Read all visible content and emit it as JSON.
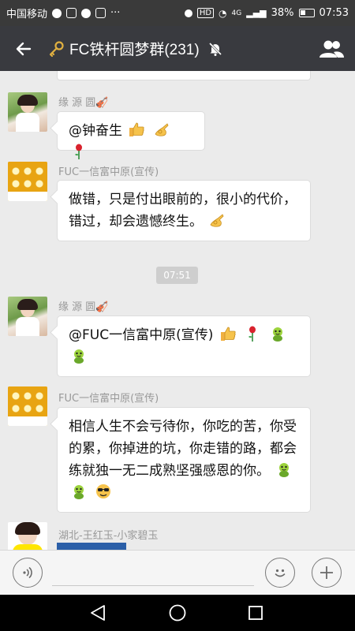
{
  "status_bar": {
    "carrier": "中国移动",
    "network": "HD",
    "signal": "4G",
    "battery": "38%",
    "time": "07:53"
  },
  "header": {
    "title": "FC铁杆圆梦群(231)",
    "back_icon": "arrow-left-icon",
    "key_icon": "key-icon",
    "mute_icon": "mute-bell-icon",
    "group_icon": "group-members-icon"
  },
  "messages": [
    {
      "sender": "缘 源 圆🎻",
      "text": "@钟奋生",
      "emojis": [
        "thumbs-up",
        "ok-hand",
        "rose"
      ]
    },
    {
      "sender": "FUC一信富中原(宣传)",
      "text": "做错，只是付出眼前的，很小的代价，错过，却会遗憾终生。",
      "emojis": [
        "ok-hand"
      ]
    },
    {
      "sender": "缘 源 圆🎻",
      "text": "@FUC一信富中原(宣传)",
      "emojis": [
        "thumbs-up",
        "rose",
        "frog",
        "frog"
      ]
    },
    {
      "sender": "FUC一信富中原(宣传)",
      "text": "相信人生不会亏待你，你吃的苦，你受的累，你掉进的坑，你走错的路，都会练就独一无二成熟坚强感恩的你。",
      "emojis": [
        "frog",
        "frog",
        "cool-face"
      ]
    },
    {
      "sender": "湖北-王红玉-小家碧玉",
      "text": ""
    }
  ],
  "timestamp": "07:51",
  "input": {
    "voice_icon": "voice-icon",
    "emoji_icon": "smiley-icon",
    "more_icon": "plus-icon"
  },
  "nav": {
    "back_icon": "triangle-back-icon",
    "home_icon": "circle-home-icon",
    "recents_icon": "square-recents-icon"
  }
}
